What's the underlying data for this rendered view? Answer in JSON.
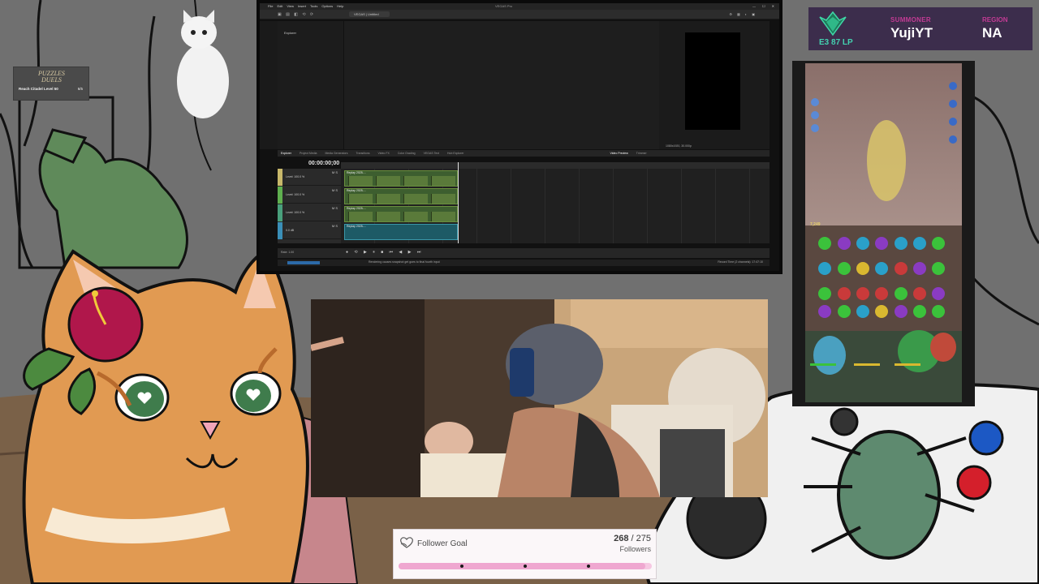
{
  "quest_widget": {
    "logo_line1": "PUZZLES",
    "logo_line2": "DUELS",
    "quest_text": "Reach Citadel Level 50",
    "progress": "6/5"
  },
  "editor": {
    "menu": [
      "File",
      "Edit",
      "View",
      "Insert",
      "Tools",
      "Options",
      "Help"
    ],
    "window_title": "VEGAS Pro",
    "project_tab": "VEGAS | Untitled",
    "explorer_label": "Explorer",
    "tabs": [
      "Explorer",
      "Project Media",
      "Media Generators",
      "Transitions",
      "Video FX",
      "Color Grading",
      "VEGAS Text",
      "Hub Explorer"
    ],
    "preview_tabs": [
      "Video Preview",
      "Trimmer"
    ],
    "timecode": "00:00:00;00",
    "tracks": [
      {
        "label": "Level: 100.0 %",
        "color": "#c8b86a"
      },
      {
        "label": "Level: 100.0 %",
        "color": "#5fb04f"
      },
      {
        "label": "Level: 100.0 %",
        "color": "#49a07c"
      },
      {
        "label": "0.0 dB",
        "color": "#3a8fb8"
      }
    ],
    "clip_label": "Replay 2025-...",
    "rate": "Rate: 1.00",
    "preview_info": "1080x1920, 30.000p",
    "status_text": "Rendering causes snapshot get goes to final fourth input",
    "status_right": "Record Time (2 channels): 17:47:10"
  },
  "rank": {
    "tier": "E3",
    "lp": "87 LP",
    "summoner_label": "SUMMONER",
    "summoner_name": "YujiYT",
    "region_label": "REGION",
    "region_name": "NA",
    "accent": "#c23b94",
    "tier_color": "#44d1b0"
  },
  "follower_goal": {
    "title": "Follower Goal",
    "current": "268",
    "target": "275",
    "unit": "Followers",
    "progress_fraction": 0.975
  }
}
